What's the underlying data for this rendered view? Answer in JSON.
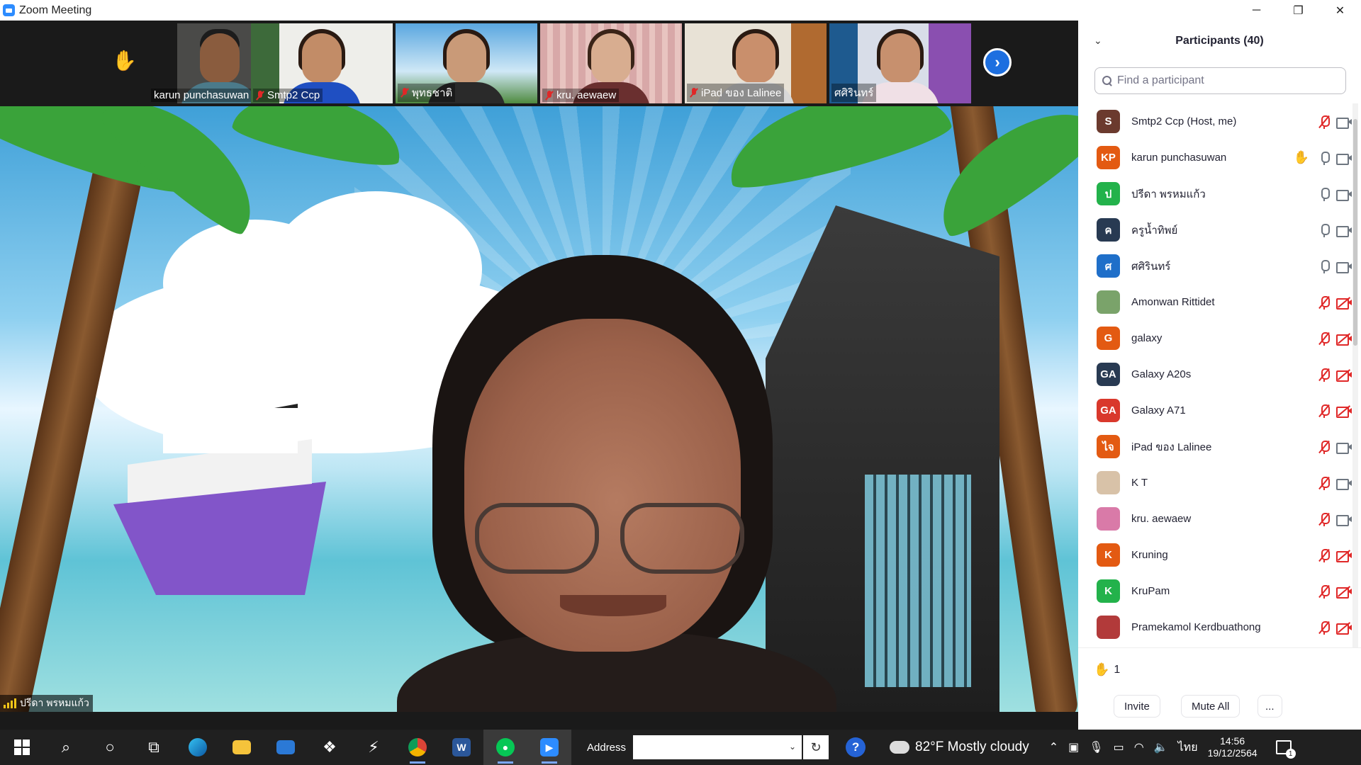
{
  "window": {
    "title": "Zoom Meeting",
    "minimize": "─",
    "maximize": "❐",
    "close": "✕"
  },
  "strip": {
    "thumbnails": [
      {
        "name": "karun punchasuwan",
        "muted": false,
        "hand": true
      },
      {
        "name": "Smtp2 Ccp",
        "muted": true
      },
      {
        "name": "พุทธชาติ",
        "muted": true
      },
      {
        "name": "kru. aewaew",
        "muted": true
      },
      {
        "name": "iPad ของ Lalinee",
        "muted": true
      },
      {
        "name": "ศศิรินทร์",
        "muted": false
      }
    ],
    "next_icon": "›"
  },
  "main_video": {
    "speaker_name": "ปรีดา  พรหมแก้ว"
  },
  "panel": {
    "collapse_icon": "⌄",
    "title": "Participants (40)",
    "search_placeholder": "Find a participant",
    "participants": [
      {
        "name": "Smtp2 Ccp (Host, me)",
        "initials": "S",
        "color": "#6b3a2e",
        "mic": "muted",
        "cam": "on"
      },
      {
        "name": "karun punchasuwan",
        "initials": "KP",
        "color": "#e35a12",
        "mic": "on",
        "cam": "on",
        "hand": true
      },
      {
        "name": "ปรีดา  พรหมแก้ว",
        "initials": "ป",
        "color": "#23b24b",
        "mic": "on",
        "cam": "on"
      },
      {
        "name": "ครูน้ำทิพย์",
        "initials": "ค",
        "color": "#283a52",
        "mic": "on",
        "cam": "on"
      },
      {
        "name": "ศศิรินทร์",
        "initials": "ศ",
        "color": "#1f6fc9",
        "mic": "on",
        "cam": "on"
      },
      {
        "name": "Amonwan Rittidet",
        "initials": "",
        "color": "#7aa36a",
        "mic": "muted",
        "cam": "off"
      },
      {
        "name": "galaxy",
        "initials": "G",
        "color": "#e35a12",
        "mic": "muted",
        "cam": "off"
      },
      {
        "name": "Galaxy A20s",
        "initials": "GA",
        "color": "#283a52",
        "mic": "muted",
        "cam": "off"
      },
      {
        "name": "Galaxy A71",
        "initials": "GA",
        "color": "#d9382c",
        "mic": "muted",
        "cam": "off"
      },
      {
        "name": "iPad ของ Lalinee",
        "initials": "ไจ",
        "color": "#e35a12",
        "mic": "muted",
        "cam": "on"
      },
      {
        "name": "K T",
        "initials": "",
        "color": "#d8c2a8",
        "mic": "muted",
        "cam": "on"
      },
      {
        "name": "kru. aewaew",
        "initials": "",
        "color": "#d97aa8",
        "mic": "muted",
        "cam": "on"
      },
      {
        "name": "Kruning",
        "initials": "K",
        "color": "#e35a12",
        "mic": "muted",
        "cam": "off"
      },
      {
        "name": "KruPam",
        "initials": "K",
        "color": "#23b24b",
        "mic": "muted",
        "cam": "off"
      },
      {
        "name": "Pramekamol Kerdbuathong",
        "initials": "",
        "color": "#b23a3a",
        "mic": "muted",
        "cam": "off"
      }
    ],
    "raised_hands_count": "1",
    "invite_label": "Invite",
    "mute_all_label": "Mute All",
    "more_label": "..."
  },
  "taskbar": {
    "address_label": "Address",
    "address_value": "",
    "weather": "82°F  Mostly cloudy",
    "language": "ไทย",
    "time": "14:56",
    "date": "19/12/2564",
    "notification_count": "1",
    "word_letter": "W"
  }
}
